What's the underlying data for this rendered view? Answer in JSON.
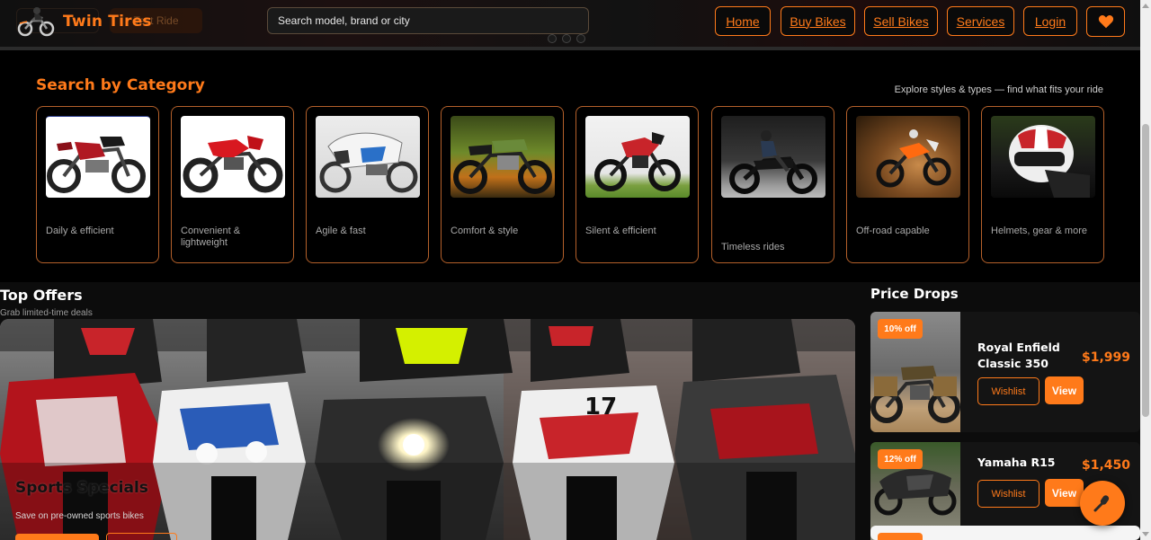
{
  "header": {
    "brand": "Twin Tires",
    "hero_button": "Test Ride",
    "search_placeholder": "Search model, brand or city",
    "nav": [
      "Home",
      "Buy Bikes",
      "Sell Bikes",
      "Services",
      "Login"
    ],
    "wishlist_icon": "heart-icon"
  },
  "categories": {
    "title": "Search by Category",
    "subtitle": "Explore styles & types — find what fits your ride",
    "items": [
      {
        "desc": "Daily & efficient"
      },
      {
        "desc": "Convenient & lightweight"
      },
      {
        "desc": "Agile & fast"
      },
      {
        "desc": "Comfort & style"
      },
      {
        "desc": "Silent & efficient"
      },
      {
        "desc": "Timeless rides"
      },
      {
        "desc": "Off-road capable"
      },
      {
        "desc": "Helmets, gear & more"
      }
    ]
  },
  "offers": {
    "title": "Top Offers",
    "subtitle": "Grab limited-time deals",
    "banner_title": "Sports Specials",
    "banner_subtitle": "Save on pre-owned sports bikes"
  },
  "price_drops": {
    "title": "Price Drops",
    "items": [
      {
        "badge": "10% off",
        "name": "Royal Enfield Classic 350",
        "price": "$1,999",
        "wishlist": "Wishlist",
        "view": "View"
      },
      {
        "badge": "12% off",
        "name": "Yamaha R15",
        "price": "$1,450",
        "wishlist": "Wishlist",
        "view": "View"
      }
    ]
  },
  "colors": {
    "accent": "#ff7a1a",
    "background": "#000000",
    "card": "#141414"
  },
  "fab_icon": "microphone-icon"
}
